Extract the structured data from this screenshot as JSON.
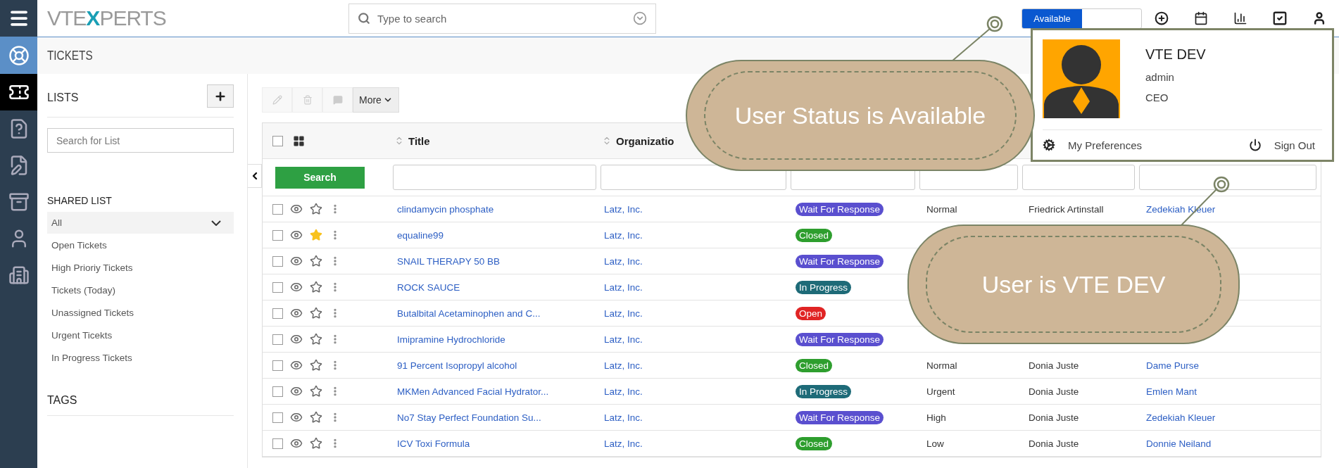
{
  "header": {
    "logo": [
      "VTE",
      "X",
      "PERTS"
    ],
    "search": {
      "placeholder": "Type to search"
    },
    "user_status": {
      "label": "Available",
      "on": true
    }
  },
  "rail": [
    {
      "kind": "module",
      "selected": false
    },
    {
      "kind": "tickets",
      "selected": true
    },
    {
      "kind": "faq",
      "selected": false
    },
    {
      "kind": "notes",
      "selected": false
    },
    {
      "kind": "cabinet",
      "selected": false
    },
    {
      "kind": "contacts",
      "selected": false
    },
    {
      "kind": "organizations",
      "selected": false
    }
  ],
  "module": {
    "title": "TICKETS"
  },
  "lists": {
    "title": "LISTS",
    "search": {
      "placeholder": "Search for List"
    },
    "shared_title": "SHARED LIST",
    "items": [
      {
        "label": "All",
        "selected": true
      },
      {
        "label": "Open Tickets",
        "selected": false
      },
      {
        "label": "High Prioriy Tickets",
        "selected": false
      },
      {
        "label": "Tickets (Today)",
        "selected": false
      },
      {
        "label": "Unassigned Tickets",
        "selected": false
      },
      {
        "label": "Urgent Ticekts",
        "selected": false
      },
      {
        "label": "In Progress Tickets",
        "selected": false
      }
    ],
    "tags_title": "TAGS"
  },
  "toolbar": {
    "actions": [
      {
        "kind": "edit",
        "disabled": true
      },
      {
        "kind": "delete",
        "disabled": true
      },
      {
        "kind": "comment",
        "disabled": true
      }
    ],
    "more": {
      "label": "More"
    }
  },
  "table": {
    "select_all": {
      "checked": false
    },
    "columns": [
      {
        "label": "Title"
      },
      {
        "label": "Organizatio"
      }
    ],
    "filter_button": "Search",
    "rows": [
      {
        "checked": false,
        "starred": false,
        "title": "clindamycin phosphate",
        "organization": "Latz, Inc.",
        "status": {
          "label": "Wait For Response",
          "color": "#5a4fcf"
        },
        "priority": "Normal",
        "contact": "Friedrick Artinstall",
        "assigned": "Zedekiah Kleuer"
      },
      {
        "checked": false,
        "starred": true,
        "title": "equaline99",
        "organization": "Latz, Inc.",
        "status": {
          "label": "Closed",
          "color": "#2e9e2e"
        }
      },
      {
        "checked": false,
        "starred": false,
        "title": "SNAIL THERAPY 50 BB",
        "organization": "Latz, Inc.",
        "status": {
          "label": "Wait For Response",
          "color": "#5a4fcf"
        }
      },
      {
        "checked": false,
        "starred": false,
        "title": "ROCK SAUCE",
        "organization": "Latz, Inc.",
        "status": {
          "label": "In Progress",
          "color": "#1e6b78"
        }
      },
      {
        "checked": false,
        "starred": false,
        "title": "Butalbital Acetaminophen and C...",
        "organization": "Latz, Inc.",
        "status": {
          "label": "Open",
          "color": "#e02424"
        }
      },
      {
        "checked": false,
        "starred": false,
        "title": "Imipramine Hydrochloride",
        "organization": "Latz, Inc.",
        "status": {
          "label": "Wait For Response",
          "color": "#5a4fcf"
        }
      },
      {
        "checked": false,
        "starred": false,
        "title": "91 Percent Isopropyl alcohol",
        "organization": "Latz, Inc.",
        "status": {
          "label": "Closed",
          "color": "#2e9e2e"
        },
        "priority": "Normal",
        "contact": "Donia Juste",
        "assigned": "Dame Purse"
      },
      {
        "checked": false,
        "starred": false,
        "title": "MKMen Advanced Facial Hydrator...",
        "organization": "Latz, Inc.",
        "status": {
          "label": "In Progress",
          "color": "#1e6b78"
        },
        "priority": "Urgent",
        "contact": "Donia Juste",
        "assigned": "Emlen Mant"
      },
      {
        "checked": false,
        "starred": false,
        "title": "No7 Stay Perfect Foundation Su...",
        "organization": "Latz, Inc.",
        "status": {
          "label": "Wait For Response",
          "color": "#5a4fcf"
        },
        "priority": "High",
        "contact": "Donia Juste",
        "assigned": "Zedekiah Kleuer"
      },
      {
        "checked": false,
        "starred": false,
        "title": "ICV Toxi Formula",
        "organization": "Latz, Inc.",
        "status": {
          "label": "Closed",
          "color": "#2e9e2e"
        },
        "priority": "Low",
        "contact": "Donia Juste",
        "assigned": "Donnie Neiland"
      }
    ]
  },
  "profile_menu": {
    "name": "VTE DEV",
    "username": "admin",
    "role": "CEO",
    "items": [
      {
        "kind": "preferences",
        "label": "My Preferences"
      },
      {
        "kind": "sign_out",
        "label": "Sign Out"
      }
    ]
  },
  "callouts": [
    {
      "text": "User Status is Available"
    },
    {
      "text": "User is VTE DEV"
    }
  ]
}
